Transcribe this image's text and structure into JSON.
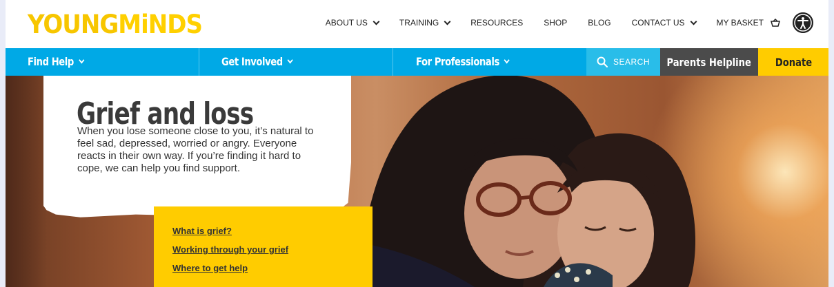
{
  "brand": {
    "name_part1": "YOUNG",
    "name_part2": "MiNDS",
    "yellow": "#ffcc00",
    "blue": "#00a9e6",
    "dark": "#4b4b4b"
  },
  "top_nav": {
    "items": [
      {
        "label": "ABOUT US",
        "has_dropdown": true
      },
      {
        "label": "TRAINING",
        "has_dropdown": true
      },
      {
        "label": "RESOURCES",
        "has_dropdown": false
      },
      {
        "label": "SHOP",
        "has_dropdown": false
      },
      {
        "label": "BLOG",
        "has_dropdown": false
      },
      {
        "label": "CONTACT US",
        "has_dropdown": true
      },
      {
        "label": "MY BASKET",
        "icon": "basket-icon"
      }
    ],
    "accessibility_icon": "accessibility-icon"
  },
  "main_nav": {
    "find_help": "Find Help",
    "get_involved": "Get Involved",
    "for_professionals": "For Professionals",
    "search": "SEARCH",
    "parents_helpline": "Parents Helpline",
    "donate": "Donate"
  },
  "hero": {
    "title": "Grief and loss",
    "intro": "When you lose someone close to you, it’s natural to feel sad, depressed, worried or angry. Everyone reacts in their own way. If you’re finding it hard to cope, we can help you find support.",
    "links": [
      "What is grief?",
      "Working through your grief",
      "Where to get help"
    ]
  }
}
